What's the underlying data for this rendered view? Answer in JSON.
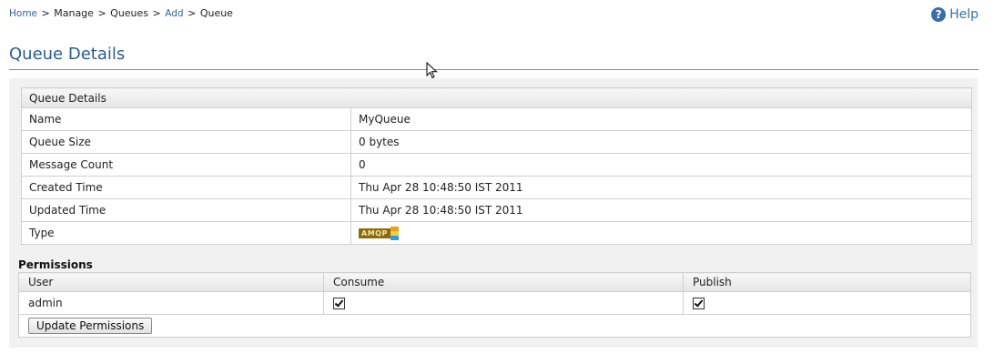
{
  "breadcrumb": {
    "home": "Home",
    "sep": ">",
    "manage": "Manage",
    "queues": "Queues",
    "add": "Add",
    "current": "Queue"
  },
  "help": {
    "label": "Help",
    "icon": "question-circle-icon"
  },
  "page": {
    "title": "Queue Details"
  },
  "details": {
    "header": "Queue Details",
    "rows": [
      {
        "label": "Name",
        "value": "MyQueue"
      },
      {
        "label": "Queue Size",
        "value": "0 bytes"
      },
      {
        "label": "Message Count",
        "value": "0"
      },
      {
        "label": "Created Time",
        "value": "Thu Apr 28 10:48:50 IST 2011"
      },
      {
        "label": "Updated Time",
        "value": "Thu Apr 28 10:48:50 IST 2011"
      },
      {
        "label": "Type",
        "value": "AMQP",
        "icon": "amqp-logo-icon"
      }
    ]
  },
  "permissions": {
    "heading": "Permissions",
    "columns": [
      "User",
      "Consume",
      "Publish"
    ],
    "rows": [
      {
        "user": "admin",
        "consume": true,
        "publish": true
      }
    ],
    "update_button": "Update Permissions"
  },
  "colors": {
    "title": "#2d5d8c",
    "link": "#3a5f9a",
    "panel_bg": "#f1f1f1"
  }
}
